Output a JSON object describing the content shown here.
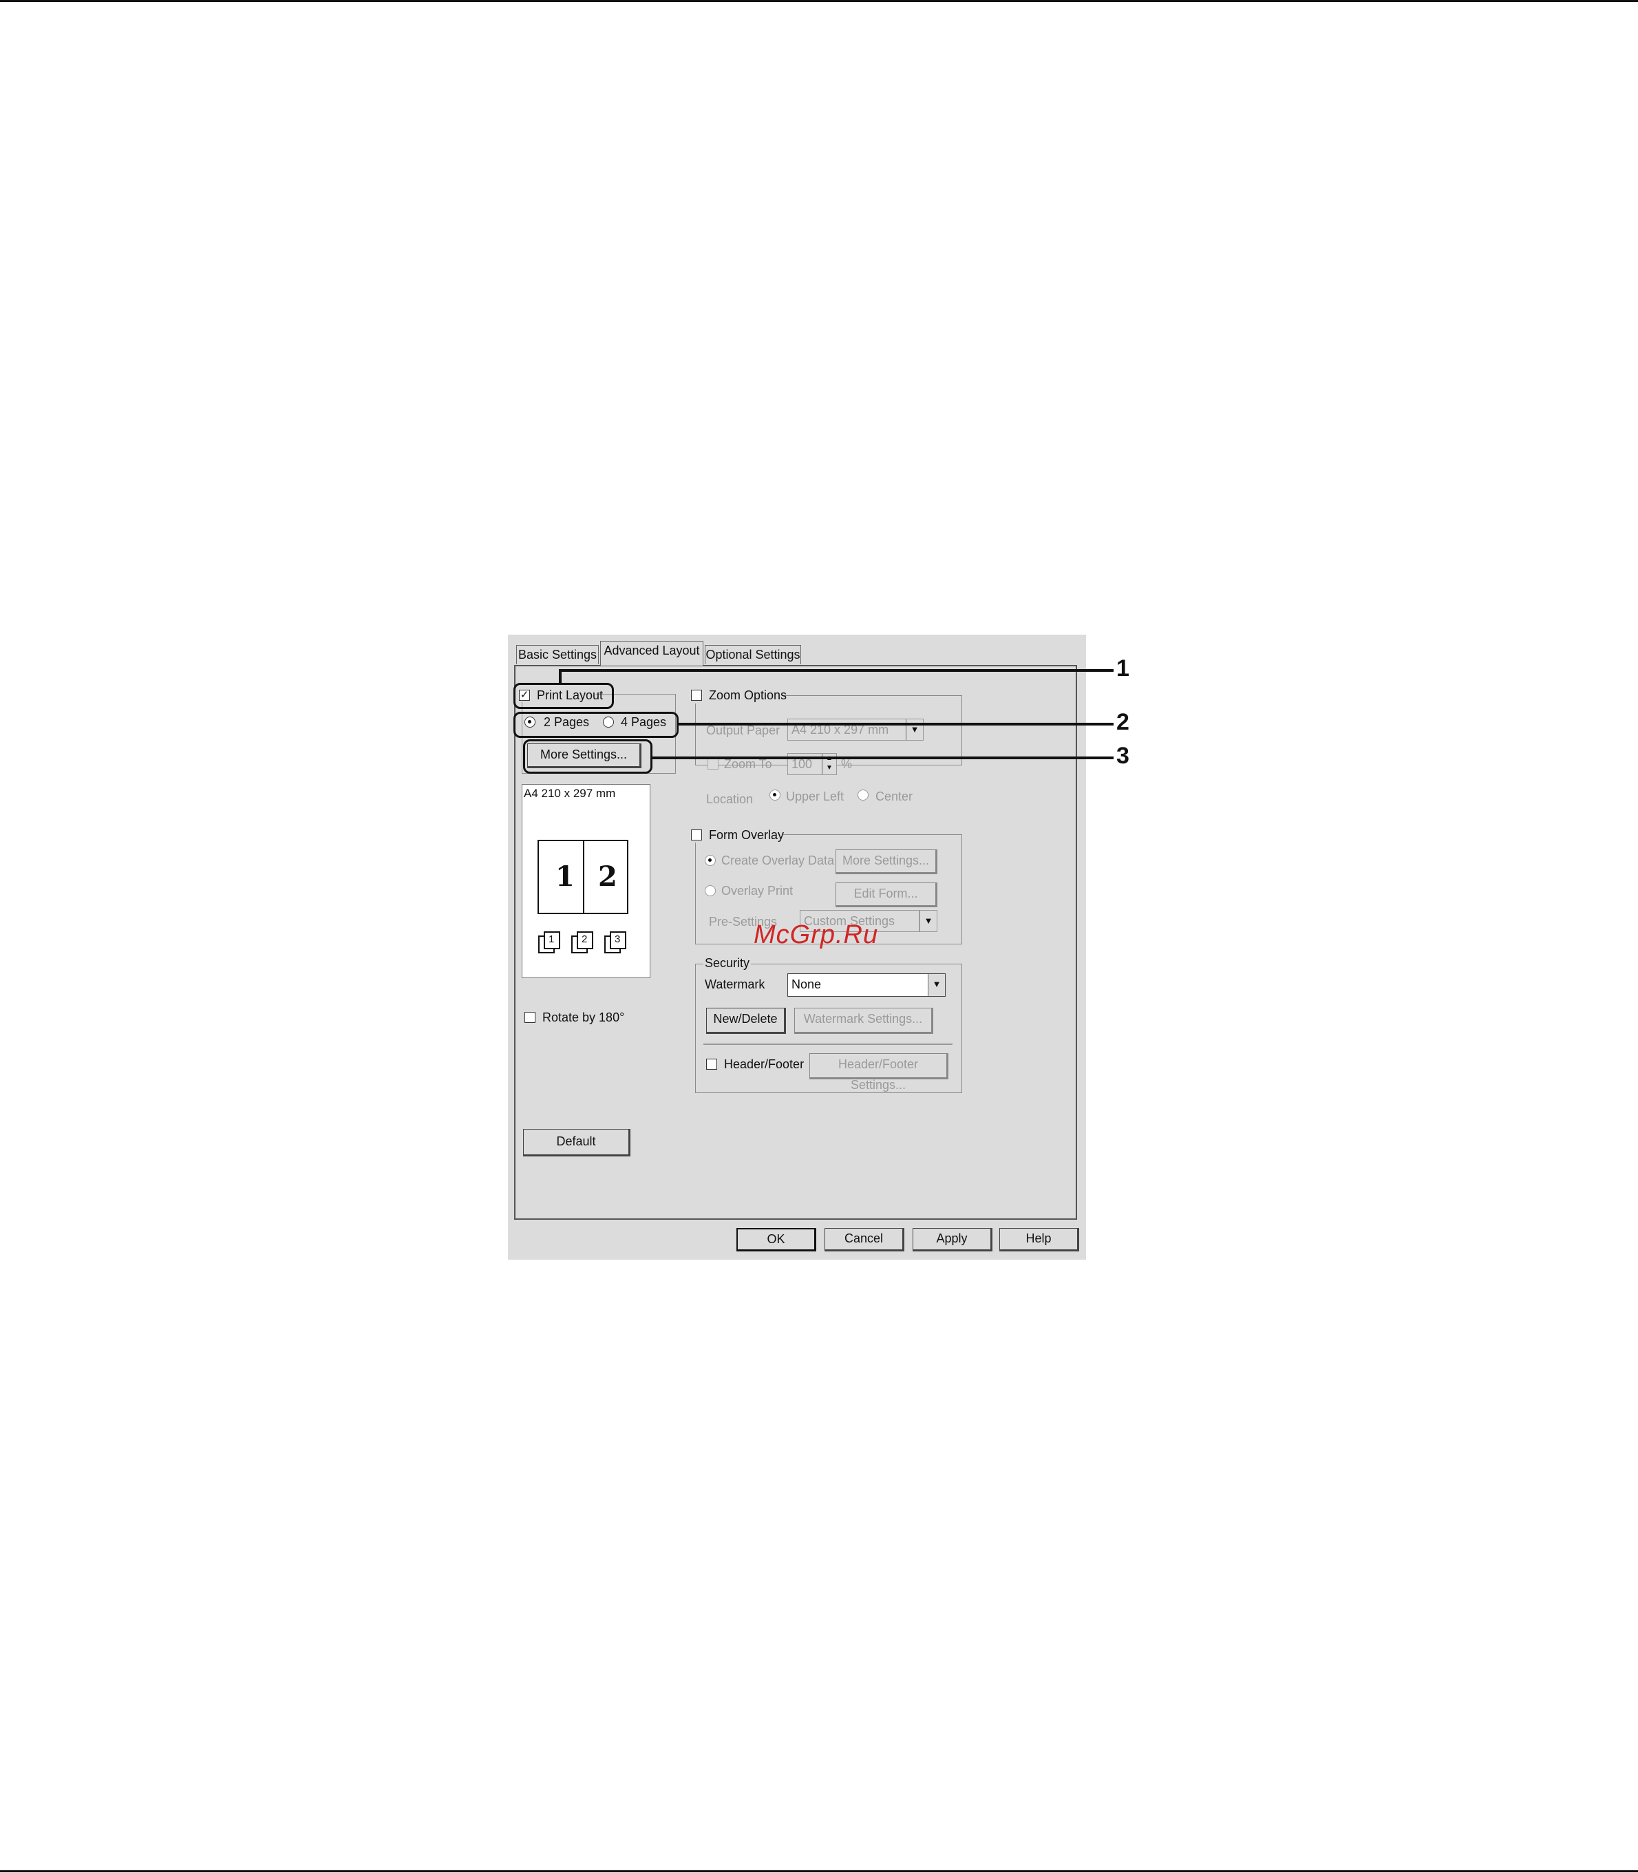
{
  "tabs": [
    "Basic Settings",
    "Advanced Layout",
    "Optional Settings"
  ],
  "print_layout": {
    "label": "Print Layout",
    "checked": true,
    "options": [
      "2 Pages",
      "4 Pages"
    ],
    "selected": "2 Pages",
    "more_settings": "More Settings..."
  },
  "preview": {
    "paper": "A4 210 x 297 mm",
    "page_numbers": [
      "1",
      "2"
    ],
    "collate_icons": [
      "1",
      "2",
      "3"
    ]
  },
  "rotate": {
    "label": "Rotate by 180°",
    "checked": false
  },
  "zoom_options": {
    "label": "Zoom Options",
    "checked": false,
    "output_paper_label": "Output Paper",
    "output_paper_value": "A4 210 x 297 mm",
    "zoom_to_label": "Zoom To",
    "zoom_to_value": "100",
    "zoom_to_unit": "%",
    "location_label": "Location",
    "location_options": [
      "Upper Left",
      "Center"
    ]
  },
  "form_overlay": {
    "label": "Form Overlay",
    "checked": false,
    "create_label": "Create Overlay Data",
    "create_button": "More Settings...",
    "overlay_print_label": "Overlay Print",
    "edit_form_button": "Edit Form...",
    "pre_settings_label": "Pre-Settings",
    "pre_settings_value": "Custom Settings"
  },
  "security": {
    "label": "Security",
    "watermark_label": "Watermark",
    "watermark_value": "None",
    "new_delete_button": "New/Delete",
    "watermark_settings_button": "Watermark Settings...",
    "header_footer_label": "Header/Footer",
    "header_footer_checked": false,
    "header_footer_settings_button": "Header/Footer Settings..."
  },
  "default_button": "Default",
  "footer_buttons": [
    "OK",
    "Cancel",
    "Apply",
    "Help"
  ],
  "callouts": [
    "1",
    "2",
    "3"
  ],
  "watermark_text": "McGrp.Ru"
}
